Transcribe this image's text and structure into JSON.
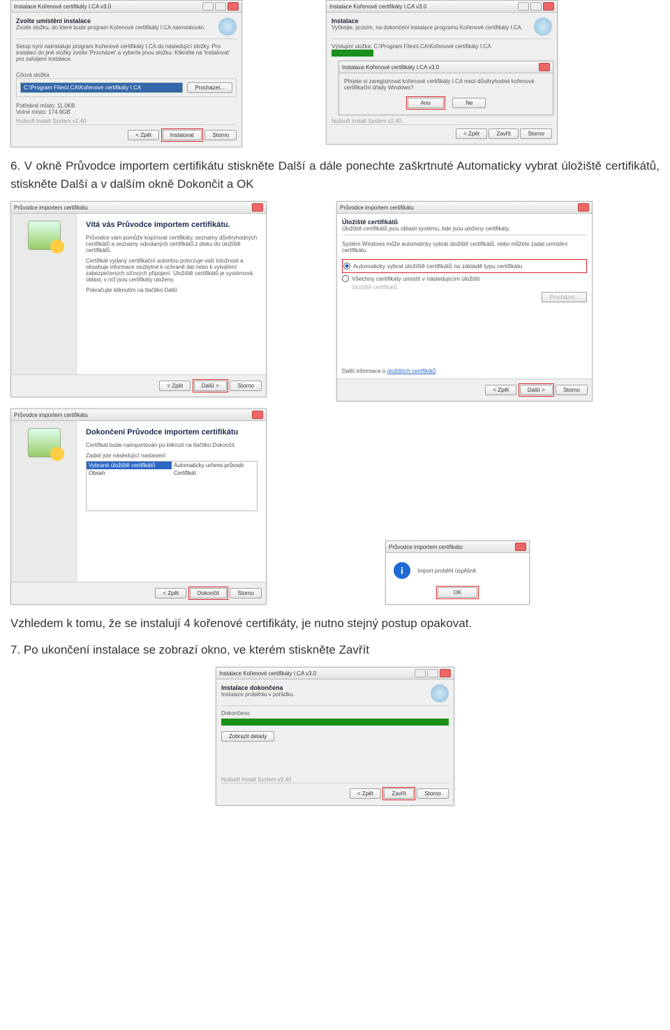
{
  "row1a": {
    "title": "Instalace Kořenové certifikáty I.CA v3.0",
    "h": "Zvolte umístění instalace",
    "hsub": "Zvolte složku, do které bude program Kořenové certifikáty I.CA nainstalován.",
    "body": "Setup nyní nainstaluje program Kořenové certifikáty I.CA do následující složky. Pro instalaci do jiné složky zvolte 'Procházet' a vyberte jinou složku. Klikněte na 'Instalovat' pro zahájení instalace.",
    "dest_label": "Cílová složka",
    "dest_value": "C:\\Program Files\\I.CA\\Kořenové certifikáty I.CA",
    "browse": "Procházet...",
    "req": "Potřebné místo: 11.0KB",
    "free": "Volné místo: 174.9GB",
    "sys": "Nullsoft Install System v2.40",
    "back": "< Zpět",
    "install": "Instalovat",
    "storno": "Storno"
  },
  "row1b": {
    "title": "Instalace Kořenové certifikáty I.CA v3.0",
    "h": "Instalace",
    "hsub": "Vyčkejte, prosím, na dokončení instalace programu Kořenové certifikáty I.CA.",
    "outlabel": "Výstupní složka: C:\\Program Files\\I.CA\\Kořenové certifikáty I.CA",
    "popup_title": "Instalace Kořenové certifikáty I.CA v3.0",
    "popup_text": "Přejete si zaregistrovat kořenové certifikáty I.CA mezi důvěryhodné kořenové certifikační úřady Windows?",
    "yes": "Ano",
    "no": "Ne",
    "sys": "Nullsoft Install System v2.40",
    "back": "< Zpět",
    "close": "Zavřít",
    "storno": "Storno"
  },
  "para1": "6. V okně Průvodce importem certifikátu stiskněte Další a dále ponechte zaškrtnuté Automaticky vybrat úložiště certifikátů, stiskněte Další a v dalším okně Dokončit a OK",
  "wiz1": {
    "title": "Průvodce importem certifikátu",
    "h": "Vítá vás Průvodce importem certifikátu.",
    "p1": "Průvodce vám pomůže kopírovat certifikáty, seznamy důvěryhodných certifikátů a seznamy odvolaných certifikátů z disku do úložiště certifikátů.",
    "p2": "Certifikát vydaný certifikační autoritou potvrzuje vaši totožnost a obsahuje informace nezbytné k ochraně dat nebo k vytváření zabezpečených síťových připojení. Úložiště certifikátů je systémová oblast, v níž jsou certifikáty uloženy.",
    "p3": "Pokračujte kliknutím na tlačítko Další.",
    "back": "< Zpět",
    "next": "Další >",
    "storno": "Storno"
  },
  "wiz2": {
    "title": "Průvodce importem certifikátu",
    "h": "Úložiště certifikátů",
    "hsub": "Úložiště certifikátů jsou oblasti systému, kde jsou uloženy certifikáty.",
    "body": "Systém Windows může automaticky vybrat úložiště certifikátů, nebo můžete zadat umístění certifikátu.",
    "r1": "Automaticky vybrat úložiště certifikátů na základě typu certifikátu",
    "r2": "Všechny certifikáty umístit v následujícím úložišti",
    "store_label": "Úložiště certifikátů:",
    "browse": "Procházet...",
    "more": "Další informace o",
    "more_link": "úložištích certifikátů",
    "back": "< Zpět",
    "next": "Další >",
    "storno": "Storno"
  },
  "wiz3": {
    "title": "Průvodce importem certifikátu",
    "h": "Dokončení Průvodce importem certifikátu",
    "p1": "Certifikát bude naimportován po kliknutí na tlačítko Dokončit.",
    "p2": "Zadali jste následující nastavení:",
    "c1a": "Vybrané úložiště certifikátů",
    "c1b": "Automaticky určeno průvodc",
    "c2a": "Obsah",
    "c2b": "Certifikát",
    "back": "< Zpět",
    "done": "Dokončit",
    "storno": "Storno"
  },
  "okpop": {
    "title": "Průvodce importem certifikátu",
    "msg": "Import proběhl úspěšně.",
    "ok": "OK"
  },
  "para2": "Vzhledem k tomu, že se instalují 4 kořenové certifikáty, je nutno stejný postup opakovat.",
  "para3": "7. Po ukončení instalace se zobrazí okno, ve kterém stiskněte Zavřít",
  "final": {
    "title": "Instalace Kořenové certifikáty I.CA v3.0",
    "h": "Instalace dokončena",
    "hsub": "Instalace proběhla v pořádku.",
    "done": "Dokončeno",
    "detail": "Zobrazit detaily",
    "sys": "Nullsoft Install System v2.40",
    "back": "< Zpět",
    "close": "Zavřít",
    "storno": "Storno"
  }
}
